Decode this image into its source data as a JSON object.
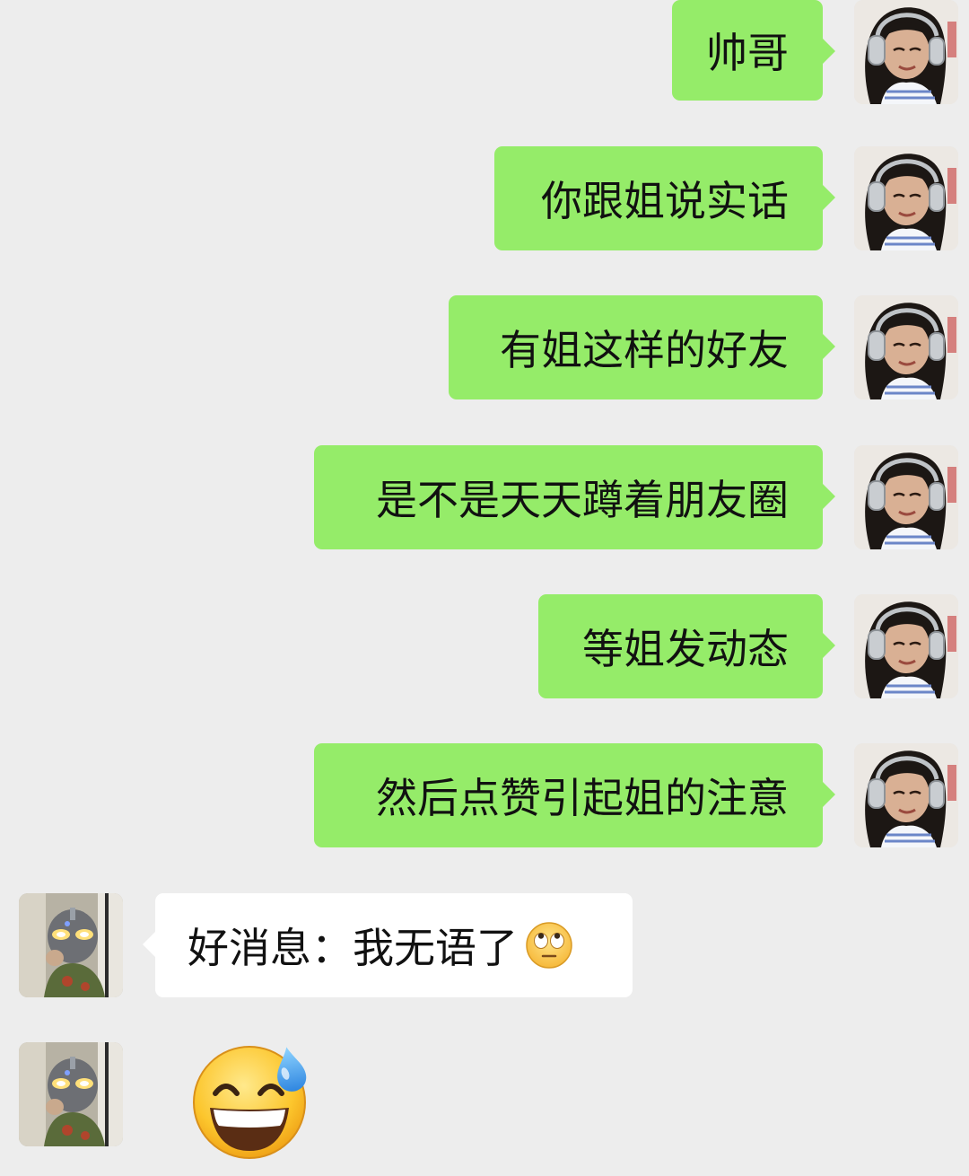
{
  "chat": {
    "messages": [
      {
        "direction": "out",
        "sender": "self",
        "text": "帅哥"
      },
      {
        "direction": "out",
        "sender": "self",
        "text": "你跟姐说实话"
      },
      {
        "direction": "out",
        "sender": "self",
        "text": "有姐这样的好友"
      },
      {
        "direction": "out",
        "sender": "self",
        "text": "是不是天天蹲着朋友圈"
      },
      {
        "direction": "out",
        "sender": "self",
        "text": "等姐发动态"
      },
      {
        "direction": "out",
        "sender": "self",
        "text": "然后点赞引起姐的注意"
      },
      {
        "direction": "in",
        "sender": "other",
        "text": "好消息：我无语了",
        "emoji": "eye-roll-emoji"
      },
      {
        "direction": "in",
        "sender": "other",
        "emoji": "grinning-sweat-emoji"
      }
    ]
  },
  "colors": {
    "background": "#ededed",
    "outgoing_bubble": "#95ec69",
    "incoming_bubble": "#ffffff",
    "text": "#111111"
  },
  "icons": {
    "self_avatar": "avatar-girl-headphones",
    "other_avatar": "avatar-glowing-eyes-figure"
  }
}
